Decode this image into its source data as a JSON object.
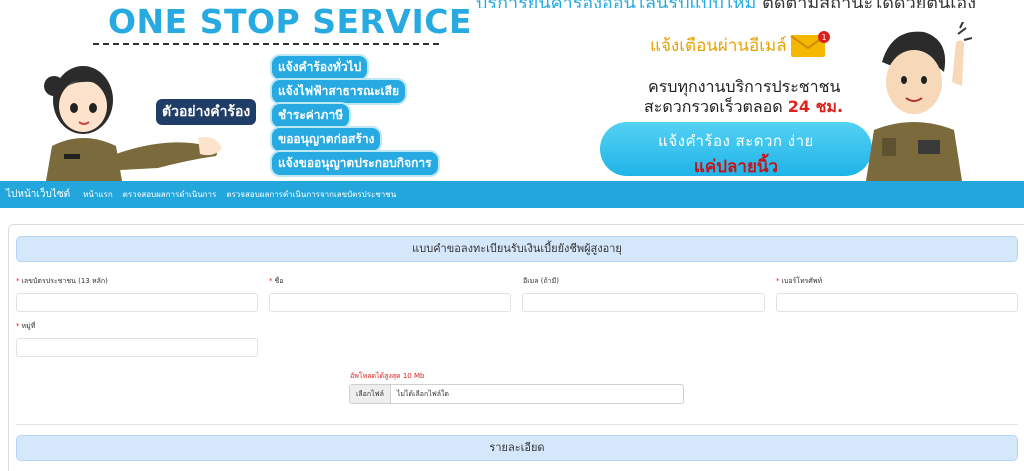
{
  "banner": {
    "title": "ONE STOP SERVICE",
    "top_text_blue": "บริการยื่นคำร้องออนไลน์รูปแบบใหม่",
    "top_text_dark": "ติดตามสถานะได้ด้วยตนเอง",
    "example_label": "ตัวอย่างคำร้อง",
    "services": [
      "แจ้งคำร้องทั่วไป",
      "แจ้งไฟฟ้าสาธารณะเสีย",
      "ชำระค่าภาษี",
      "ขออนุญาตก่อสร้าง",
      "แจ้งขออนุญาตประกอบกิจการ"
    ],
    "email_notice": "แจ้งเตือนผ่านอีเมล์",
    "mail_badge": "1",
    "service_line1": "ครบทุกงานบริการประชาชน",
    "service_line2_prefix": "สะดวกรวดเร็วตลอด",
    "service_line2_highlight": "24 ชม.",
    "cta_line1": "แจ้งคำร้อง สะดวก ง่าย",
    "cta_line2": "แค่ปลายนิ้ว"
  },
  "nav": {
    "home": "ไปหน้าเว็บไซต์",
    "items": [
      "หน้าแรก",
      "ตรวจสอบผลการดำเนินการ",
      "ตรวจสอบผลการดำเนินการจากเลขบัตรประชาชน"
    ]
  },
  "form": {
    "section_title": "แบบคำขอลงทะเบียนรับเงินเบี้ยยังชีพผู้สูงอายุ",
    "fields": [
      {
        "label": "เลขบัตรประชาชน (13 หลัก)",
        "required": true
      },
      {
        "label": "ชื่อ",
        "required": true
      },
      {
        "label": "อีเมล (ถ้ามี)",
        "required": false
      },
      {
        "label": "เบอร์โทรศัพท์",
        "required": true
      },
      {
        "label": "หมู่ที่",
        "required": true
      }
    ],
    "required_mark": "*",
    "upload_hint": "อัพโหลดได้สูงสุด 10 Mb",
    "file_button": "เลือกไฟล์",
    "file_status": "ไม่ได้เลือกไฟล์ใด",
    "details_title": "รายละเอียด"
  },
  "colors": {
    "brand_blue": "#27a9e1",
    "nav_blue": "#22a6dc",
    "section_bg": "#d5e8fb",
    "required_red": "#e0201b"
  }
}
